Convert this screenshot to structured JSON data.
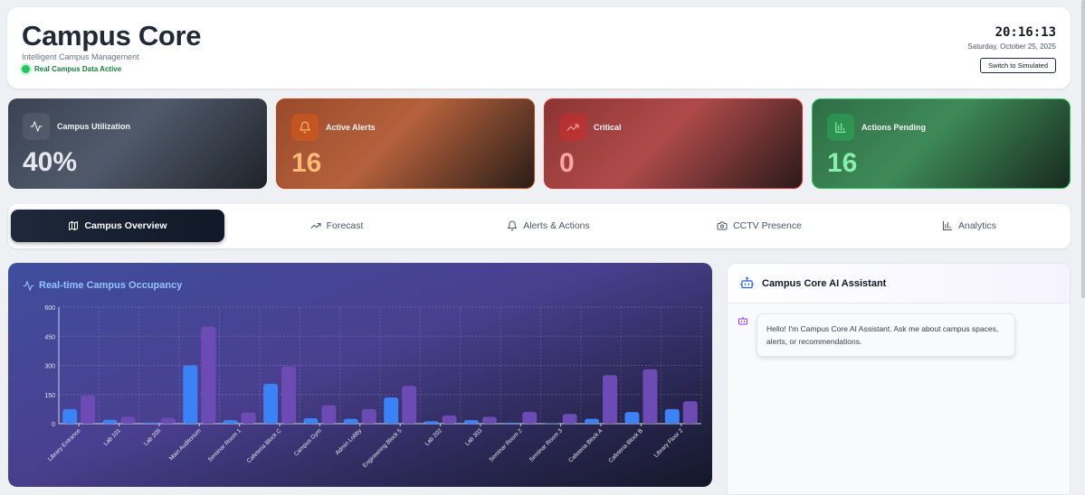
{
  "header": {
    "title": "Campus Core",
    "subtitle": "Intelligent Campus Management",
    "status": "Real Campus Data Active",
    "time": "20:16:13",
    "date": "Saturday, October 25, 2025",
    "mode_button": "Switch to Simulated"
  },
  "stats": [
    {
      "label": "Campus Utilization",
      "value": "40%",
      "icon": "activity-icon"
    },
    {
      "label": "Active Alerts",
      "value": "16",
      "icon": "bell-icon"
    },
    {
      "label": "Critical",
      "value": "0",
      "icon": "trending-up-icon"
    },
    {
      "label": "Actions Pending",
      "value": "16",
      "icon": "bar-chart-icon"
    }
  ],
  "tabs": [
    {
      "label": "Campus Overview",
      "icon": "map-icon",
      "active": true
    },
    {
      "label": "Forecast",
      "icon": "trending-up-icon",
      "active": false
    },
    {
      "label": "Alerts & Actions",
      "icon": "bell-icon",
      "active": false
    },
    {
      "label": "CCTV Presence",
      "icon": "camera-icon",
      "active": false
    },
    {
      "label": "Analytics",
      "icon": "bar-chart-icon",
      "active": false
    }
  ],
  "chart_data": {
    "type": "bar",
    "title": "Real-time Campus Occupancy",
    "categories": [
      "Library Entrance",
      "Lab 101",
      "Lab 205",
      "Main Auditorium",
      "Seminar Room 1",
      "Cafeteria Block C",
      "Campus Gym",
      "Admin Lobby",
      "Engineering Block 5",
      "Lab 202",
      "Lab 303",
      "Seminar Room 2",
      "Seminar Room 3",
      "Cafeteria Block A",
      "Cafeteria Block B",
      "Library Floor 2"
    ],
    "series": [
      {
        "values": [
          75,
          20,
          5,
          300,
          18,
          205,
          28,
          25,
          135,
          12,
          18,
          5,
          2,
          25,
          60,
          75
        ],
        "color": "#3b82f6"
      },
      {
        "values": [
          145,
          35,
          30,
          500,
          58,
          295,
          95,
          75,
          195,
          42,
          35,
          60,
          50,
          250,
          280,
          115
        ],
        "color": "#6d4bb5"
      }
    ],
    "yticks": [
      0,
      150,
      300,
      450,
      600
    ],
    "ylim": [
      0,
      600
    ],
    "grid": true
  },
  "assistant": {
    "title": "Campus Core AI Assistant",
    "greeting": "Hello! I'm Campus Core AI Assistant. Ask me about campus spaces, alerts, or recommendations."
  }
}
